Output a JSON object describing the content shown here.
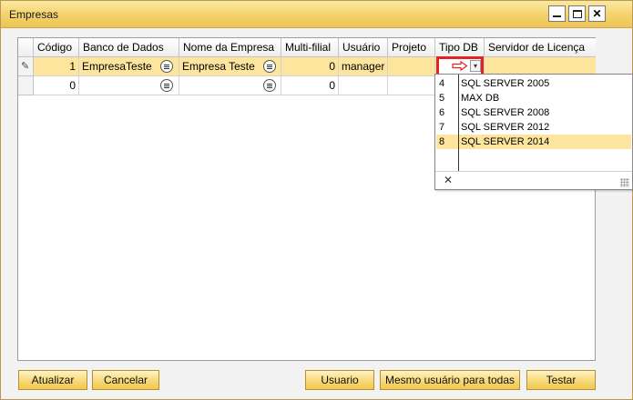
{
  "window": {
    "title": "Empresas"
  },
  "controls": {
    "minimize": "minimize",
    "maximize": "maximize",
    "close": "✕"
  },
  "grid": {
    "columns": [
      "Código",
      "Banco de Dados",
      "Nome da Empresa",
      "Multi-filial",
      "Usuário",
      "Projeto",
      "Tipo DB",
      "Servidor de Licença"
    ],
    "rows": [
      {
        "codigo": "1",
        "banco": "EmpresaTeste",
        "nome": "Empresa Teste",
        "multifilial": "0",
        "usuario": "manager",
        "projeto": "",
        "tipo_db": "",
        "servidor": ""
      },
      {
        "codigo": "0",
        "banco": "",
        "nome": "",
        "multifilial": "0",
        "usuario": "",
        "projeto": "",
        "tipo_db": "",
        "servidor": ""
      }
    ]
  },
  "tipo_db_dropdown": {
    "options": [
      {
        "code": "4",
        "name": "SQL SERVER 2005"
      },
      {
        "code": "5",
        "name": "MAX DB"
      },
      {
        "code": "6",
        "name": "SQL SERVER 2008"
      },
      {
        "code": "7",
        "name": "SQL SERVER 2012"
      },
      {
        "code": "8",
        "name": "SQL SERVER 2014"
      }
    ],
    "selected_code": "8",
    "close_label": "✕"
  },
  "buttons": {
    "atualizar": "Atualizar",
    "cancelar": "Cancelar",
    "usuario": "Usuario",
    "mesmo_usuario": "Mesmo usuário para todas",
    "testar": "Testar"
  },
  "colors": {
    "title_bar": "#f4d16a",
    "selected_row": "#fde59e",
    "highlight_border": "#e32222",
    "button": "#f7d672"
  },
  "icons": [
    "pencil-icon",
    "lookup-icon",
    "arrow-right-icon",
    "dropdown-arrow-icon",
    "close-icon",
    "resize-grip-icon"
  ]
}
